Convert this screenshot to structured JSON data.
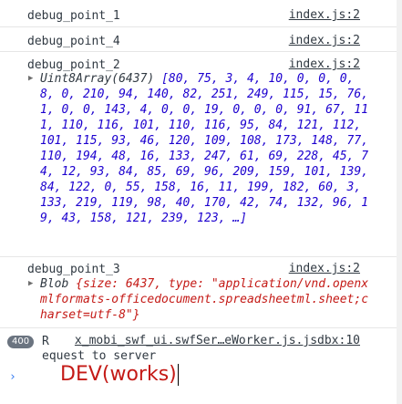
{
  "rows": [
    {
      "message": "debug_point_1",
      "source": "index.js:2"
    },
    {
      "message": "debug_point_4",
      "source": "index.js:2"
    },
    {
      "message": "debug_point_2",
      "source": "index.js:2",
      "detail_type": "Uint8Array(6437)",
      "detail_values": "[80, 75, 3, 4, 10, 0, 0, 0, 8, 0, 210, 94, 140, 82, 251, 249, 115, 15, 76, 1, 0, 0, 143, 4, 0, 0, 19, 0, 0, 0, 91, 67, 111, 110, 116, 101, 110, 116, 95, 84, 121, 112, 101, 115, 93, 46, 120, 109, 108, 173, 148, 77, 110, 194, 48, 16, 133, 247, 61, 69, 228, 45, 74, 12, 93, 84, 85, 69, 96, 209, 159, 101, 139, 84, 122, 0, 55, 158, 16, 11, 199, 182, 60, 3, 133, 219, 119, 98, 40, 170, 42, 74, 132, 96, 19, 43, 158, 121, 239, 123, …]"
    },
    {
      "message": "debug_point_3",
      "source": "index.js:2",
      "detail_type": "Blob",
      "detail_values": "{size: 6437, type: \"application/vnd.openxmlformats-officedocument.spreadsheetml.sheet;charset=utf-8\"}"
    },
    {
      "badge": "400",
      "message": "R",
      "source": "x_mobi_swf_ui.swfSer…eWorker.js.jsdbx:10",
      "continuation": "equest to server"
    }
  ],
  "console_input": {
    "prompt": "›",
    "value": "DEV(works)"
  }
}
